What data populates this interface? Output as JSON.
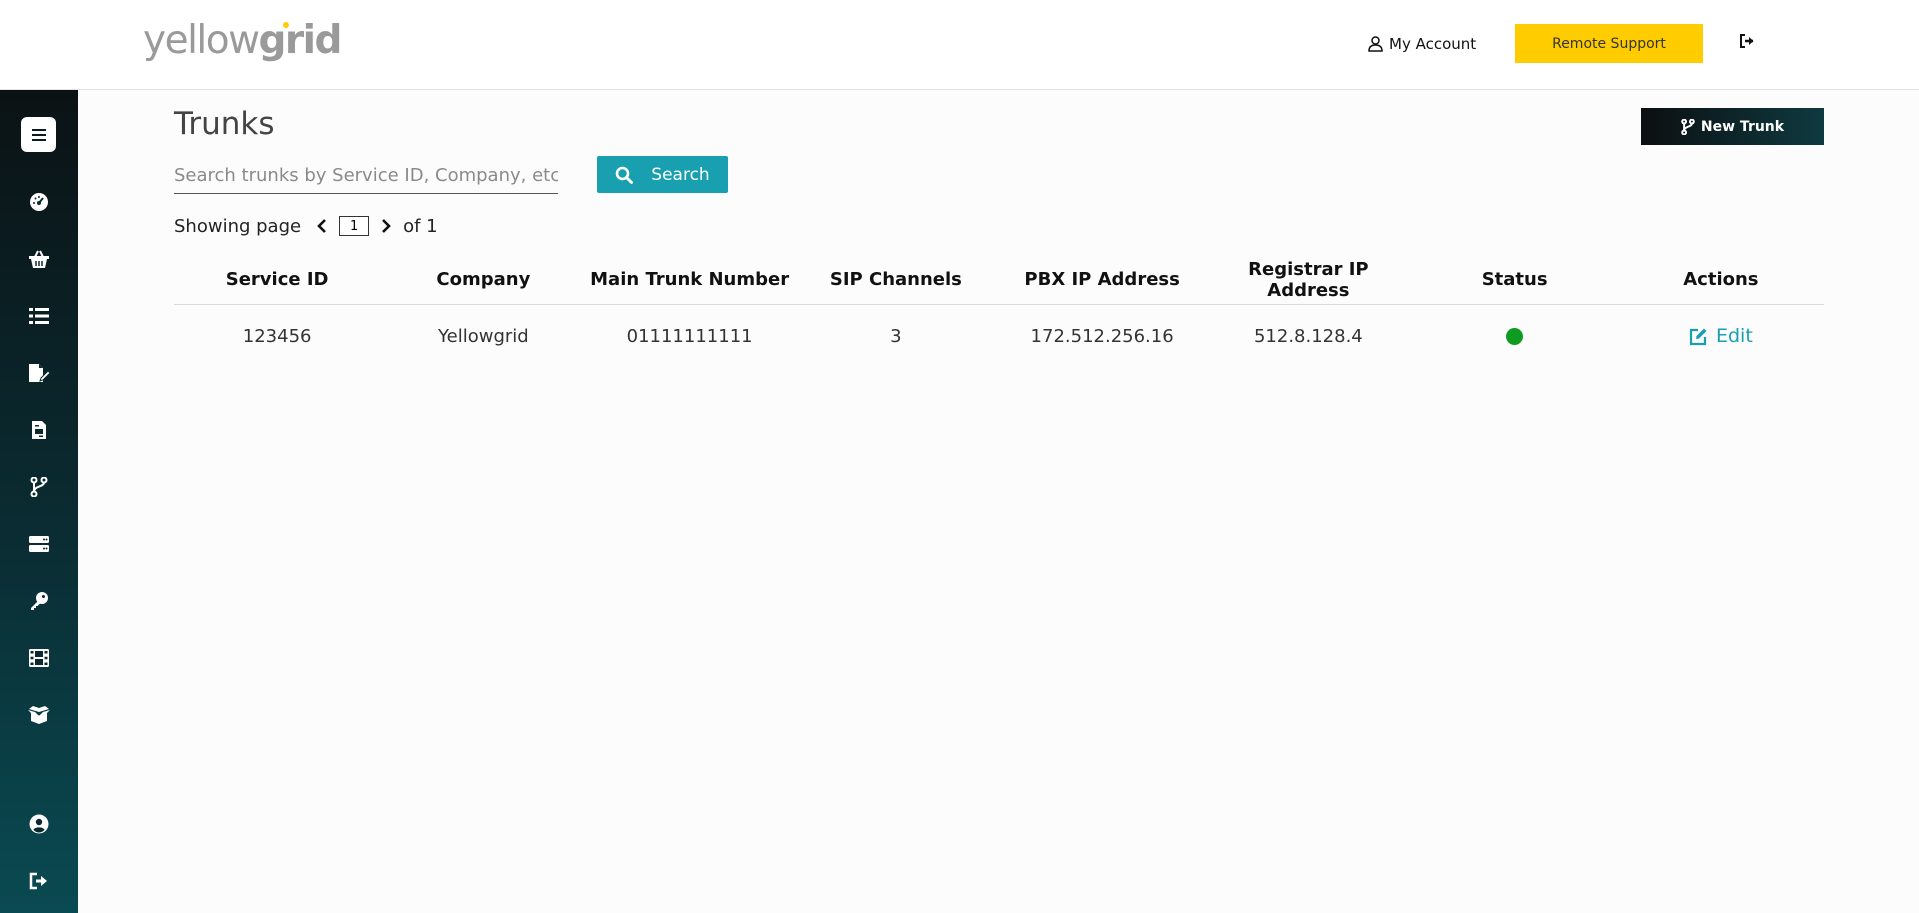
{
  "brand": {
    "part1": "yellow",
    "part2": "grid",
    "accent": "#ffcc00"
  },
  "header": {
    "account_label": "My Account",
    "remote_support_label": "Remote Support"
  },
  "sidebar": {
    "items": [
      {
        "icon": "dashboard-icon"
      },
      {
        "icon": "basket-icon"
      },
      {
        "icon": "list-icon"
      },
      {
        "icon": "file-signature-icon"
      },
      {
        "icon": "file-invoice-icon"
      },
      {
        "icon": "code-branch-icon"
      },
      {
        "icon": "server-icon"
      },
      {
        "icon": "key-icon"
      },
      {
        "icon": "film-icon"
      },
      {
        "icon": "box-open-icon"
      }
    ],
    "bottom": [
      {
        "icon": "user-circle-icon"
      },
      {
        "icon": "sign-out-icon"
      }
    ]
  },
  "page": {
    "title": "Trunks",
    "new_button_label": "New Trunk"
  },
  "search": {
    "placeholder": "Search trunks by Service ID, Company, etc.",
    "value": "",
    "button_label": "Search"
  },
  "pagination": {
    "prefix": "Showing page",
    "current_page": "1",
    "suffix": "of 1"
  },
  "table": {
    "columns": [
      "Service ID",
      "Company",
      "Main Trunk Number",
      "SIP Channels",
      "PBX IP Address",
      "Registrar IP Address",
      "Status",
      "Actions"
    ],
    "rows": [
      {
        "service_id": "123456",
        "company": "Yellowgrid",
        "main_trunk_number": "01111111111",
        "sip_channels": "3",
        "pbx_ip": "172.512.256.16",
        "registrar_ip": "512.8.128.4",
        "status": "active",
        "status_color": "#0e9b22",
        "action_label": "Edit"
      }
    ]
  }
}
